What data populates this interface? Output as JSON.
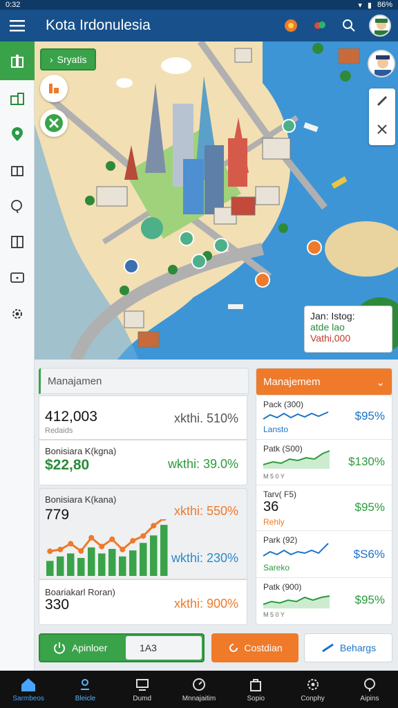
{
  "status": {
    "left": "0:32",
    "right": "86%"
  },
  "app": {
    "title": "Kota Irdonulesia"
  },
  "map": {
    "chip_label": "Sryatis",
    "info_card": {
      "line1": "Jan: Istog:",
      "line2": "atde lao",
      "line3": "Vathi,000"
    }
  },
  "left_panel": {
    "header": "Manajamen",
    "stats": [
      {
        "value": "412,003",
        "sub": "Redaids",
        "delta": "xkthi. 510%"
      },
      {
        "label": "Bonisiara K(kgna)",
        "value": "$22,80",
        "delta": "wkthi: 39.0%"
      },
      {
        "label": "Bonisiara K(kana)",
        "value": "779",
        "delta": "xkthi: 550%"
      },
      {
        "delta": "wkthi: 230%"
      },
      {
        "label": "Boariakarl Roran)",
        "value": "330",
        "delta": "xkthi: 900%"
      }
    ],
    "bar_chart": {
      "values": [
        20,
        26,
        30,
        24,
        38,
        30,
        36,
        26,
        34,
        44,
        54,
        68
      ]
    }
  },
  "right_panel": {
    "header": "Manajemem",
    "rows": [
      {
        "label": "Pack (300)",
        "pct": "$95%",
        "word": "Lansto",
        "color": "#1a73c8"
      },
      {
        "label": "Patk (S00)",
        "pct": "$130%",
        "axis": "M  5  0  Y",
        "color": "#2a9a3a"
      },
      {
        "label": "Tarv( F5)",
        "big": "36",
        "pct": "$95%",
        "word": "Rehly",
        "color": "#ee7a2a"
      },
      {
        "label": "Park (92)",
        "pct": "$S6%",
        "word": "Sareko",
        "color": "#1a73c8"
      },
      {
        "label": "Patk (900)",
        "pct": "$95%",
        "axis": "M  5  0  Y",
        "color": "#2a9a3a"
      }
    ]
  },
  "buttons": {
    "apinloer": "Apinloer",
    "input_value": "1A3",
    "costdian": "Costdian",
    "behargs": "Behargs"
  },
  "nav": [
    {
      "label": "Sarmbeos"
    },
    {
      "label": "Bleicle"
    },
    {
      "label": "Dumd"
    },
    {
      "label": "Mnnajaitim"
    },
    {
      "label": "Sopio"
    },
    {
      "label": "Conphy"
    },
    {
      "label": "Aipins"
    }
  ]
}
